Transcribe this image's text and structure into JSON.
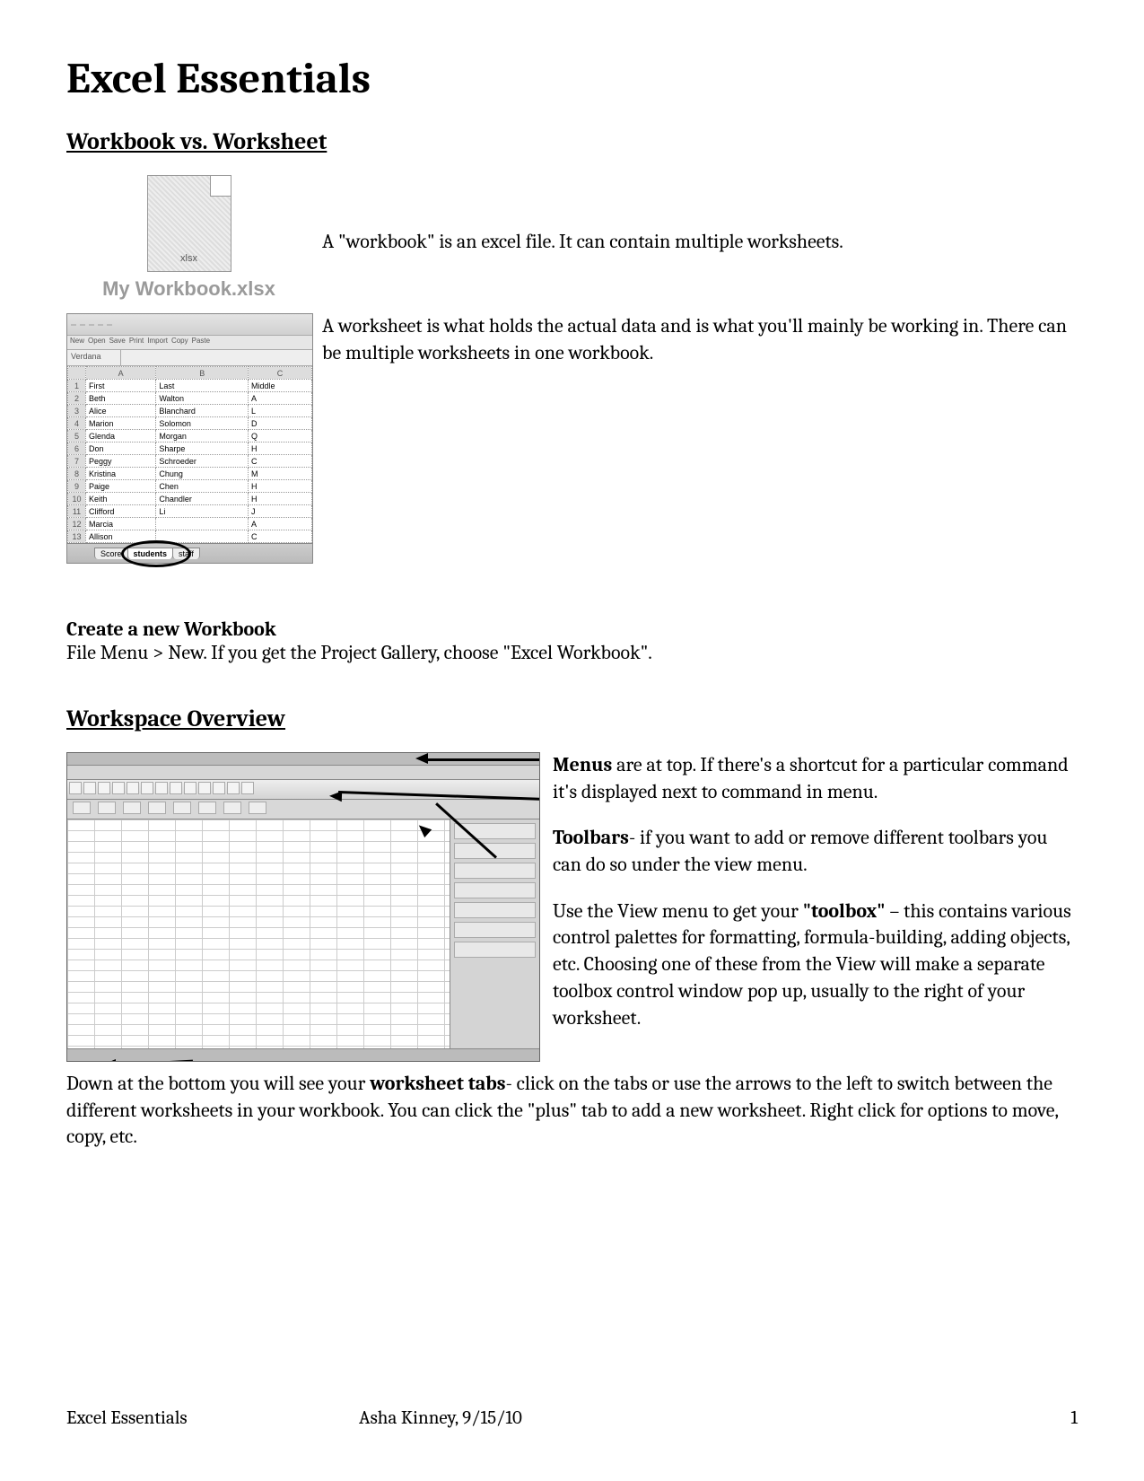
{
  "title": "Excel Essentials",
  "section1": {
    "heading": "Workbook vs. Worksheet",
    "file_ext": "xlsx",
    "workbook_label": "My Workbook.xlsx",
    "workbook_text": "A \"workbook\" is an excel file. It can contain multiple worksheets.",
    "worksheet_text": "A worksheet is what holds the actual data and is what you'll mainly be working in. There can be multiple worksheets in one workbook.",
    "namebox": "Verdana",
    "cols": [
      "",
      "A",
      "B",
      "C"
    ],
    "rows": [
      [
        "1",
        "First",
        "Last",
        "Middle"
      ],
      [
        "2",
        "Beth",
        "Walton",
        "A"
      ],
      [
        "3",
        "Alice",
        "Blanchard",
        "L"
      ],
      [
        "4",
        "Marion",
        "Solomon",
        "D"
      ],
      [
        "5",
        "Glenda",
        "Morgan",
        "Q"
      ],
      [
        "6",
        "Don",
        "Sharpe",
        "H"
      ],
      [
        "7",
        "Peggy",
        "Schroeder",
        "C"
      ],
      [
        "8",
        "Kristina",
        "Chung",
        "M"
      ],
      [
        "9",
        "Paige",
        "Chen",
        "H"
      ],
      [
        "10",
        "Keith",
        "Chandler",
        "H"
      ],
      [
        "11",
        "Clifford",
        "Li",
        "J"
      ],
      [
        "12",
        "Marcia",
        "",
        "A"
      ],
      [
        "13",
        "Allison",
        "",
        "C"
      ]
    ],
    "tabs": [
      "Score",
      "students",
      "staff"
    ],
    "create_heading": "Create a new Workbook",
    "create_text": "File Menu > New. If you get the Project Gallery, choose \"Excel Workbook\"."
  },
  "section2": {
    "heading": "Workspace Overview",
    "p1_a": "Menus",
    "p1_b": " are at top. If there's a shortcut for a particular command it's displayed next to command in menu.",
    "p2_a": "Toolbars",
    "p2_b": "- if you want to add or remove different toolbars you can do so under the view menu.",
    "p3_a": "Use the View menu to get your ",
    "p3_b": "\"toolbox\"",
    "p3_c": " – this contains various control palettes for formatting, formula-building, adding objects, etc. Choosing one of these from the View will make a separate toolbox control window pop up, usually to the right of your worksheet.",
    "bottom_a": "Down at the bottom you will see your ",
    "bottom_b": "worksheet tabs",
    "bottom_c": "- click on the tabs or use the arrows to the left to switch between the different worksheets in your workbook. You can click the \"plus\" tab to add a new worksheet. Right click for options to move, copy, etc."
  },
  "footer": {
    "left": "Excel Essentials",
    "center": "Asha Kinney, 9/15/10",
    "page": "1"
  }
}
